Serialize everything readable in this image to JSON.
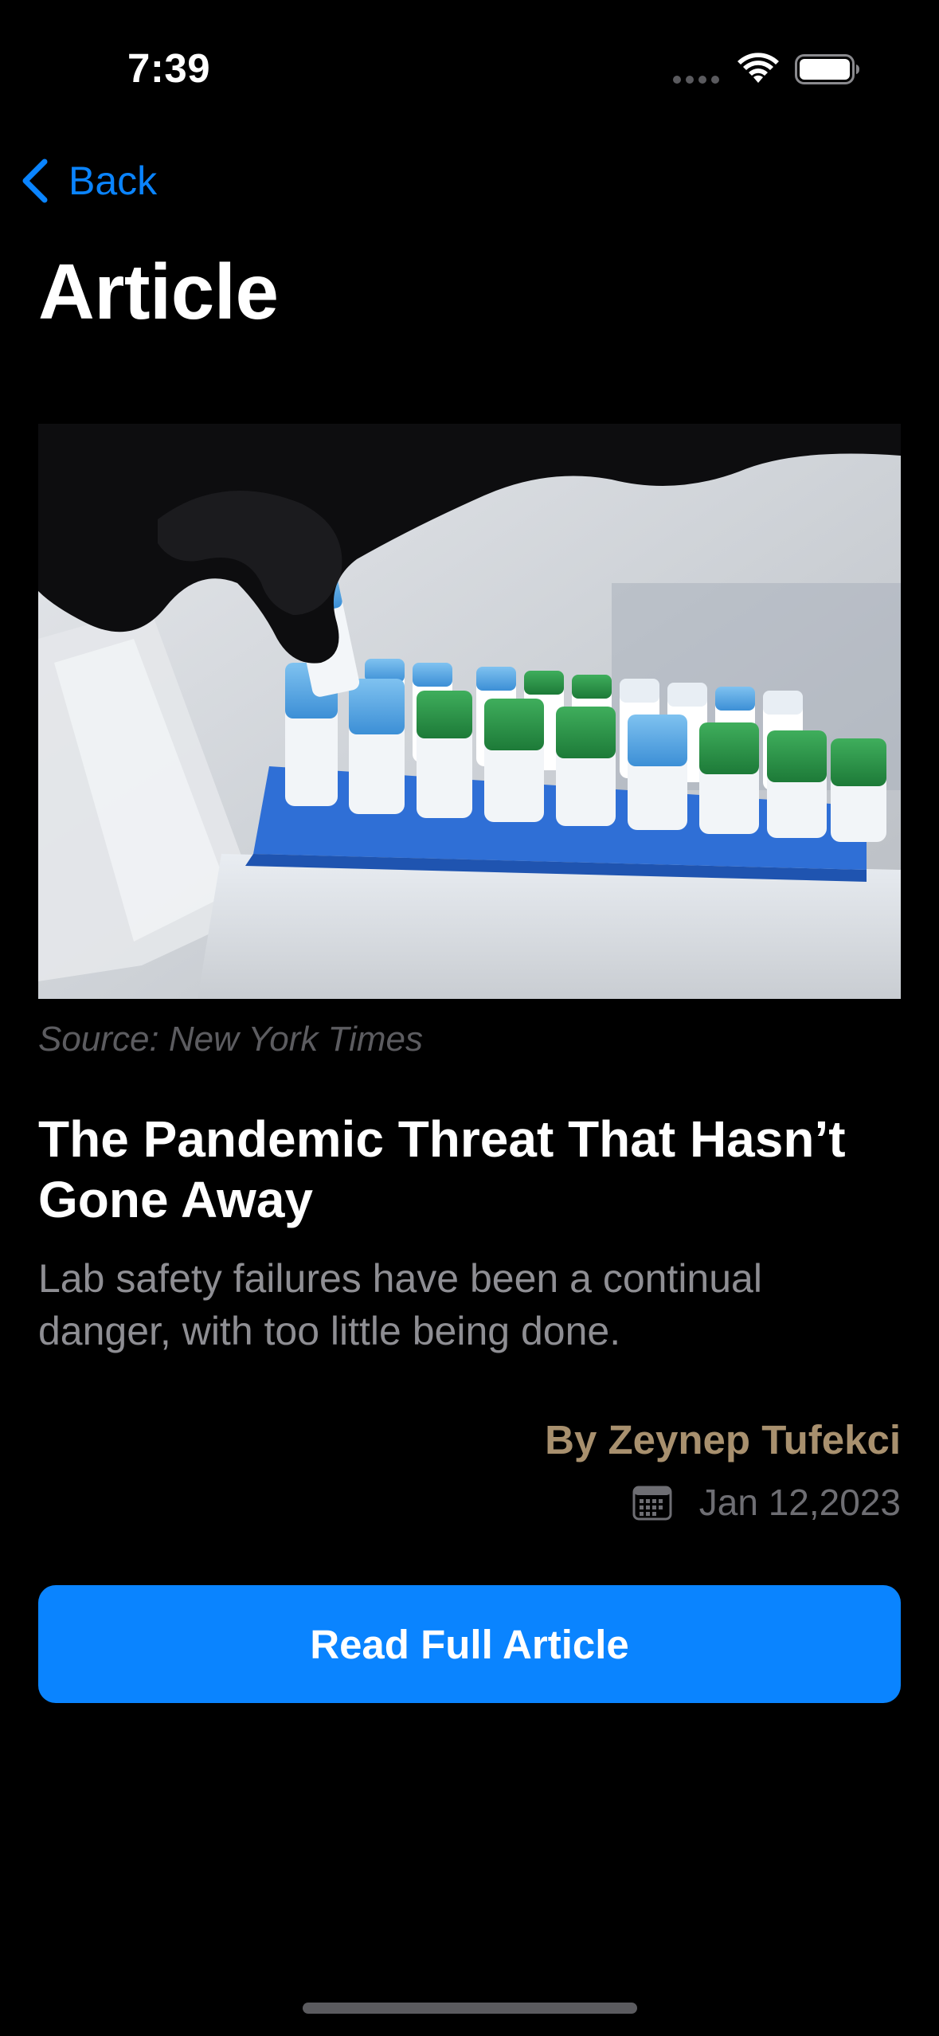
{
  "status_bar": {
    "time": "7:39"
  },
  "nav": {
    "back_label": "Back",
    "title": "Article"
  },
  "article": {
    "image_description_icon": "lab-vials-photo",
    "source": "Source: New York Times",
    "headline": "The Pandemic Threat That Hasn’t Gone Away",
    "subheadline": "Lab safety failures have been a continual danger, with too little being done.",
    "byline": "By Zeynep Tufekci",
    "date": "Jan 12,2023"
  },
  "actions": {
    "read_full_label": "Read Full Article"
  },
  "colors": {
    "background": "#000000",
    "accent": "#0a84ff",
    "byline": "#a8906e",
    "secondary_text": "#8e8e93"
  }
}
